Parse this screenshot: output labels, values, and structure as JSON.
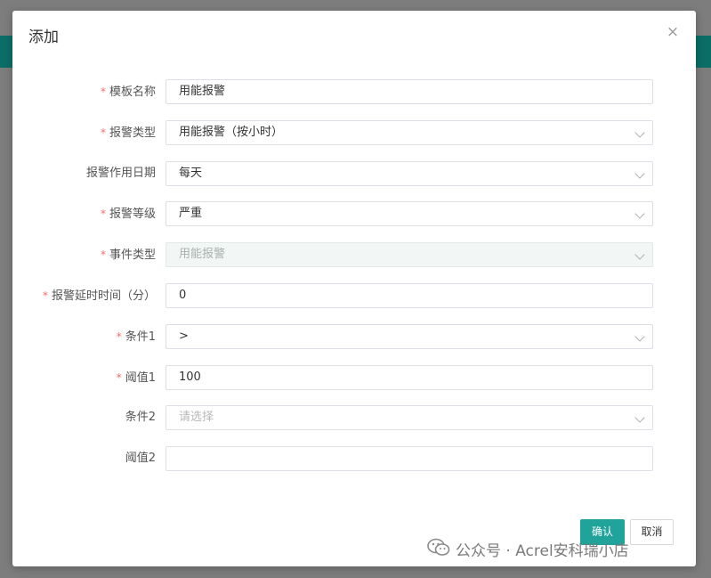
{
  "dialog": {
    "title": "添加",
    "close_glyph": "×"
  },
  "form": {
    "rows": [
      {
        "label": "模板名称",
        "required": true,
        "type": "input",
        "value": "用能报警",
        "placeholder": ""
      },
      {
        "label": "报警类型",
        "required": true,
        "type": "select",
        "value": "用能报警（按小时）",
        "placeholder": ""
      },
      {
        "label": "报警作用日期",
        "required": false,
        "type": "select",
        "value": "每天",
        "placeholder": ""
      },
      {
        "label": "报警等级",
        "required": true,
        "type": "select",
        "value": "严重",
        "placeholder": ""
      },
      {
        "label": "事件类型",
        "required": true,
        "type": "select",
        "value": "用能报警",
        "placeholder": "",
        "disabled": true
      },
      {
        "label": "报警延时时间（分）",
        "required": true,
        "type": "input",
        "value": "0",
        "placeholder": ""
      },
      {
        "label": "条件1",
        "required": true,
        "type": "select",
        "value": ">",
        "placeholder": ""
      },
      {
        "label": "阈值1",
        "required": true,
        "type": "input",
        "value": "100",
        "placeholder": ""
      },
      {
        "label": "条件2",
        "required": false,
        "type": "select",
        "value": "",
        "placeholder": "请选择"
      },
      {
        "label": "阈值2",
        "required": false,
        "type": "input",
        "value": "",
        "placeholder": ""
      }
    ],
    "required_mark": "*"
  },
  "footer": {
    "confirm_label": "确认",
    "cancel_label": "取消"
  },
  "watermark": {
    "text": "公众号 · Acrel安科瑞小店",
    "icon": "wechat-icon"
  },
  "colors": {
    "accent": "#20a39a",
    "header_bar": "#0b6e66",
    "required": "#f56c6c"
  }
}
